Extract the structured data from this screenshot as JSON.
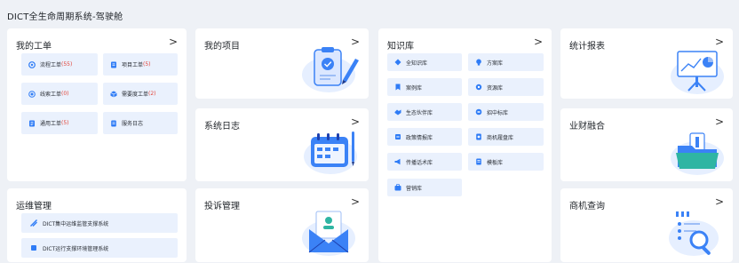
{
  "page_title": "DICT全生命周期系统-驾驶舱",
  "cards": {
    "work_orders": {
      "title": "我的工单",
      "items": [
        {
          "label": "流程工单",
          "count": "(55)",
          "icon": "flow-icon"
        },
        {
          "label": "项目工单",
          "count": "(5)",
          "icon": "project-doc-icon"
        },
        {
          "label": "线索工单",
          "count": "(0)",
          "icon": "target-icon"
        },
        {
          "label": "需要度工单",
          "count": "(2)",
          "icon": "cube-icon"
        },
        {
          "label": "通用工单",
          "count": "(5)",
          "icon": "doc-icon"
        },
        {
          "label": "服务日志",
          "count": "",
          "icon": "log-icon"
        }
      ]
    },
    "my_projects": {
      "title": "我的项目"
    },
    "system_log": {
      "title": "系统日志"
    },
    "knowledge": {
      "title": "知识库",
      "items": [
        {
          "label": "全知识库",
          "icon": "layers-icon"
        },
        {
          "label": "方案库",
          "icon": "bulb-icon"
        },
        {
          "label": "案例库",
          "icon": "bookmark-icon"
        },
        {
          "label": "资源库",
          "icon": "settings-icon"
        },
        {
          "label": "生态伙伴库",
          "icon": "handshake-icon"
        },
        {
          "label": "招中标库",
          "icon": "bid-icon"
        },
        {
          "label": "政策情报库",
          "icon": "policy-icon"
        },
        {
          "label": "商机履盘库",
          "icon": "opportunity-icon"
        },
        {
          "label": "传播话术库",
          "icon": "megaphone-icon"
        },
        {
          "label": "模板库",
          "icon": "template-icon"
        },
        {
          "label": "营销库",
          "icon": "marketing-icon"
        }
      ]
    },
    "stats": {
      "title": "统计报表"
    },
    "finance": {
      "title": "业财融合"
    },
    "ops": {
      "title": "运维管理",
      "items": [
        {
          "label": "DICT集中运维监管支撑系统",
          "icon": "monitor-icon"
        },
        {
          "label": "DICT运行支撑环境管理系统",
          "icon": "environment-icon"
        }
      ]
    },
    "complaints": {
      "title": "投诉管理"
    },
    "opportunity_query": {
      "title": "商机查询"
    }
  },
  "arrow_glyph": ">",
  "colors": {
    "accent": "#2f7cf6",
    "tile_bg": "#eaf1fd",
    "count_red": "#e3463a",
    "page_bg": "#eef1f6"
  }
}
